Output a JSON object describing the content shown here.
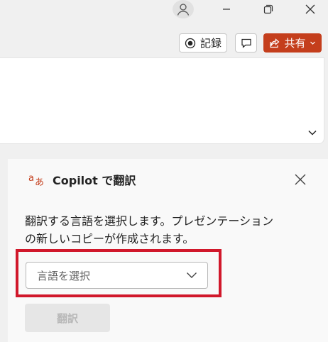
{
  "titlebar": {
    "avatar_icon": "user-avatar-icon",
    "minimize_icon": "minimize-icon",
    "restore_icon": "restore-icon",
    "close_icon": "close-icon"
  },
  "ribbon_actions": {
    "record_label": "記録",
    "comment_icon": "comment-icon",
    "share_label": "共有",
    "share_color": "#c43e1c"
  },
  "copilot_pane": {
    "title": "Copilot で翻訳",
    "description_line1": "翻訳する言語を選択します。プレゼンテーション",
    "description_line2": "の新しいコピーが作成されます。",
    "language_select_value": "言語を選択",
    "translate_button_label": "翻訳",
    "highlight_color": "#d1182b"
  }
}
